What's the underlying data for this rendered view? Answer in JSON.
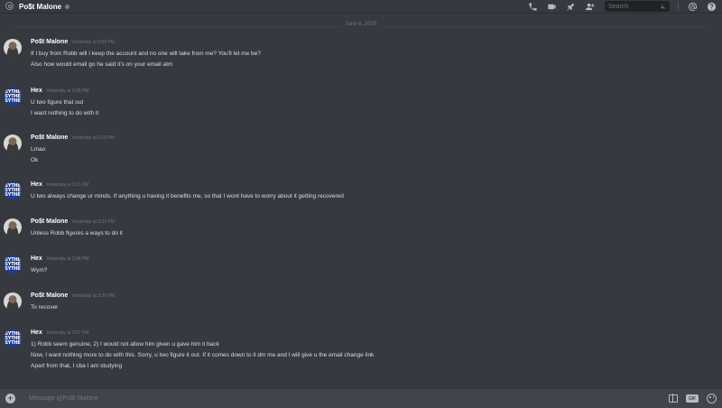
{
  "header": {
    "name": "Po$t Malone"
  },
  "search": {
    "placeholder": "Search"
  },
  "divider": {
    "date": "June 6, 2019"
  },
  "composer": {
    "placeholder": "Message @Po$t Malone",
    "gif_label": "GIF"
  },
  "messages": [
    {
      "author": "Po$t Malone",
      "avatar": "postmalone",
      "timestamp": "Yesterday at 3:09 PM",
      "lines": [
        "If I buy from Robb will I keep the account and no one will take from me? You'll let me be?",
        "Also how would email go he said it's on your email atm"
      ]
    },
    {
      "author": "Hex",
      "avatar": "hex",
      "timestamp": "Yesterday at 3:09 PM",
      "lines": [
        "U two figure that out",
        "I want nothing to do with it"
      ]
    },
    {
      "author": "Po$t Malone",
      "avatar": "postmalone",
      "timestamp": "Yesterday at 3:10 PM",
      "lines": [
        "Lmao",
        "Ok"
      ]
    },
    {
      "author": "Hex",
      "avatar": "hex",
      "timestamp": "Yesterday at 3:10 PM",
      "lines": [
        "U two always change ur minds. If anything u having it benefits me, so that I wont have to worry about it getting recovered"
      ]
    },
    {
      "author": "Po$t Malone",
      "avatar": "postmalone",
      "timestamp": "Yesterday at 3:33 PM",
      "lines": [
        "Unless Robb figures a ways to do it"
      ]
    },
    {
      "author": "Hex",
      "avatar": "hex",
      "timestamp": "Yesterday at 3:34 PM",
      "lines": [
        "Wym?"
      ]
    },
    {
      "author": "Po$t Malone",
      "avatar": "postmalone",
      "timestamp": "Yesterday at 3:35 PM",
      "lines": [
        "To recover"
      ]
    },
    {
      "author": "Hex",
      "avatar": "hex",
      "timestamp": "Yesterday at 3:37 PM",
      "lines": [
        "1) Robb seem genuine, 2) I would not allow him given u gave him it back",
        "Now, I want nothing more to do with this. Sorry, u two figure it out. If it comes down to it dm me and I will give u the email change link",
        "Apart from that, I cba I am studying"
      ]
    }
  ]
}
